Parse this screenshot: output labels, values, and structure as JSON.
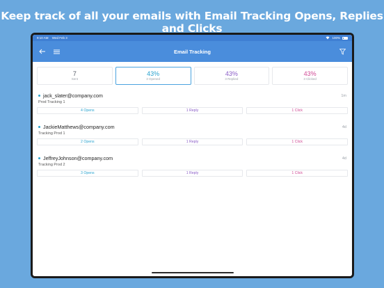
{
  "headline": "Keep track of all your emails with Email Tracking Opens, Replies and Clicks",
  "statusbar": {
    "time": "9:10 AM",
    "date": "Wed Feb 3",
    "battery": "100%"
  },
  "navbar": {
    "title": "Email Tracking",
    "icons": [
      "back-arrow-icon",
      "menu-icon",
      "filter-icon"
    ]
  },
  "colors": {
    "navbar": "#4a8ddc",
    "sent": "#555b66",
    "opened": "#2aa3cf",
    "replied": "#8a5cc7",
    "clicked": "#d04a95"
  },
  "stats": [
    {
      "value": "7",
      "label": "Sent"
    },
    {
      "value": "43%",
      "label": "3 Opened"
    },
    {
      "value": "43%",
      "label": "3 Replied"
    },
    {
      "value": "43%",
      "label": "3 Clicked"
    }
  ],
  "emails": [
    {
      "address": "jack_slater@company.com",
      "subject": "Prod Tracking 1",
      "time": "1m",
      "opens": "4 Opens",
      "replies": "1 Reply",
      "clicks": "1 Click"
    },
    {
      "address": "JackieMatthews@company.com",
      "subject": "Tracking Prod 1",
      "time": "4d",
      "opens": "2 Opens",
      "replies": "1 Reply",
      "clicks": "1 Click"
    },
    {
      "address": "JeffreyJohnson@company.com",
      "subject": "Tracking Prod 2",
      "time": "4d",
      "opens": "3 Opens",
      "replies": "1 Reply",
      "clicks": "1 Click"
    }
  ]
}
